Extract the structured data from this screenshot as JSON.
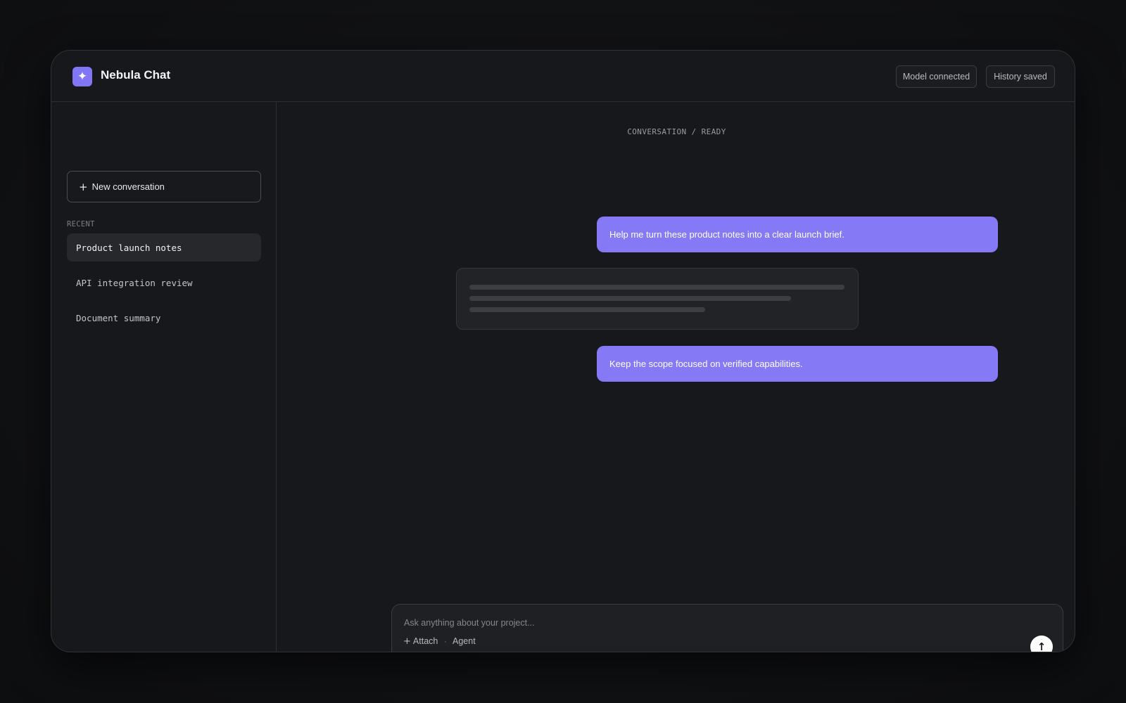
{
  "app": {
    "title": "Nebula Chat",
    "logo_icon": "sparkle-icon",
    "logo_glyph": "✦",
    "accent_color": "#8579f6"
  },
  "header": {
    "badges": [
      {
        "label": "Model connected"
      },
      {
        "label": "History saved"
      }
    ]
  },
  "sidebar": {
    "new_conversation": {
      "icon": "plus-icon",
      "glyph": "+",
      "label": "New conversation"
    },
    "recent_label": "RECENT",
    "conversations": [
      {
        "label": "Product launch notes",
        "active": true
      },
      {
        "label": "API integration review",
        "active": false
      },
      {
        "label": "Document summary",
        "active": false
      }
    ]
  },
  "conversation": {
    "status": "CONVERSATION / READY",
    "messages": [
      {
        "role": "user",
        "text": "Help me turn these product notes into a clear launch brief."
      },
      {
        "role": "assistant",
        "state": "loading"
      },
      {
        "role": "user",
        "text": "Keep the scope focused on verified capabilities."
      }
    ]
  },
  "composer": {
    "placeholder": "Ask anything about your project...",
    "value": "",
    "attach": {
      "icon": "plus-icon",
      "glyph": "+",
      "label": "Attach"
    },
    "separator": "·",
    "agent_label": "Agent",
    "send": {
      "icon": "arrow-up-icon",
      "glyph": "↑"
    }
  }
}
